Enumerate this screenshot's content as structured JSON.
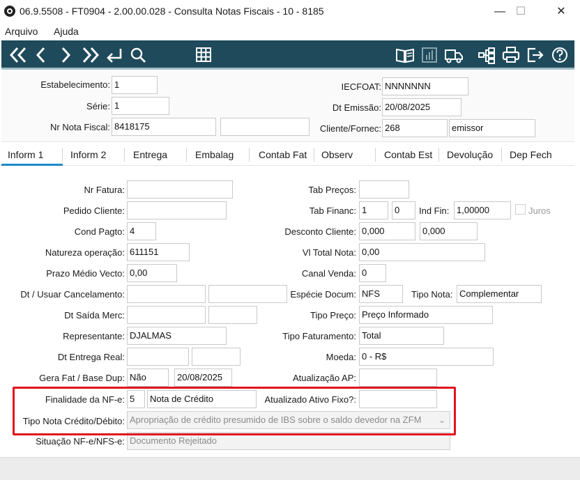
{
  "window": {
    "title": "06.9.5508 - FT0904 - 2.00.00.028 - Consulta Notas Fiscais - 10 - 8185",
    "minimize": "—",
    "maximize": "☐",
    "close": "✕"
  },
  "menu": {
    "file": "Arquivo",
    "help": "Ajuda"
  },
  "toolbar": {
    "accent": "#1e4a5b",
    "icons": [
      "first-icon",
      "previous-icon",
      "next-icon",
      "last-icon",
      "return-icon",
      "search-icon",
      "grid-icon",
      "book-icon",
      "chart-icon",
      "truck-icon",
      "hierarchy-icon",
      "print-icon",
      "exit-icon",
      "help-icon"
    ]
  },
  "header": {
    "estab_label": "Estabelecimento:",
    "estab_value": "1",
    "serie_label": "Série:",
    "serie_value": "1",
    "nrnf_label": "Nr Nota Fiscal:",
    "nrnf_value": "8418175",
    "nrnf_extra": "",
    "iecfoat_label": "IECFOAT:",
    "iecfoat_value": "NNNNNNN",
    "dtemissao_label": "Dt Emissão:",
    "dtemissao_value": "20/08/2025",
    "cliente_label": "Cliente/Fornec:",
    "cliente_code": "268",
    "cliente_name": "emissor"
  },
  "tabs": [
    "Inform 1",
    "Inform 2",
    "Entrega",
    "Embalag",
    "Contab Fat",
    "Observ",
    "Contab Est",
    "Devolução",
    "Dep Fech"
  ],
  "form": {
    "nr_fatura_label": "Nr Fatura:",
    "nr_fatura": "",
    "pedido_cliente_label": "Pedido Cliente:",
    "pedido_cliente": "",
    "cond_pagto_label": "Cond Pagto:",
    "cond_pagto": "4",
    "natureza_label": "Natureza operação:",
    "natureza": "611151",
    "prazo_label": "Prazo Médio Vecto:",
    "prazo": "0,00",
    "dt_cancel_label": "Dt / Usuar Cancelamento:",
    "dt_cancel": "",
    "usuar_cancel": "",
    "dt_saida_label": "Dt Saída Merc:",
    "dt_saida": "",
    "hr_saida": "",
    "representante_label": "Representante:",
    "representante": "DJALMAS",
    "dt_entrega_label": "Dt Entrega Real:",
    "dt_entrega": "",
    "hr_entrega": "",
    "gera_fat_label": "Gera Fat / Base Dup:",
    "gera_fat": "Não",
    "base_dup": "20/08/2025",
    "finalidade_label": "Finalidade da NF-e:",
    "finalidade_code": "5",
    "finalidade_desc": "Nota de Crédito",
    "tipo_nota_credito_label": "Tipo Nota Crédito/Débito:",
    "tipo_nota_credito": "Apropriação de crédito presumido de IBS sobre o saldo devedor na ZFM",
    "situacao_label": "Situação NF-e/NFS-e:",
    "situacao": "Documento Rejeitado",
    "tab_precos_label": "Tab Preços:",
    "tab_precos": "",
    "tab_financ_label": "Tab Financ:",
    "tab_financ_1": "1",
    "tab_financ_2": "0",
    "ind_fin_label": "Ind Fin:",
    "ind_fin": "1,00000",
    "juros_label": "Juros",
    "desconto_label": "Desconto Cliente:",
    "desconto_1": "0,000",
    "desconto_2": "0,000",
    "vl_total_label": "Vl Total Nota:",
    "vl_total": "0,00",
    "canal_label": "Canal Venda:",
    "canal": "0",
    "especie_label": "Espécie Docum:",
    "especie": "NFS",
    "tipo_nota_label": "Tipo Nota:",
    "tipo_nota": "Complementar",
    "tipo_preco_label": "Tipo Preço:",
    "tipo_preco": "Preço Informado",
    "tipo_fat_label": "Tipo Faturamento:",
    "tipo_fat": "Total",
    "moeda_label": "Moeda:",
    "moeda": "0 - R$",
    "atualizacao_ap_label": "Atualização AP:",
    "atualizacao_ap": "",
    "atualizado_ativo_label": "Atualizado Ativo Fixo?:",
    "atualizado_ativo": ""
  },
  "highlight_color": "#e0141e"
}
